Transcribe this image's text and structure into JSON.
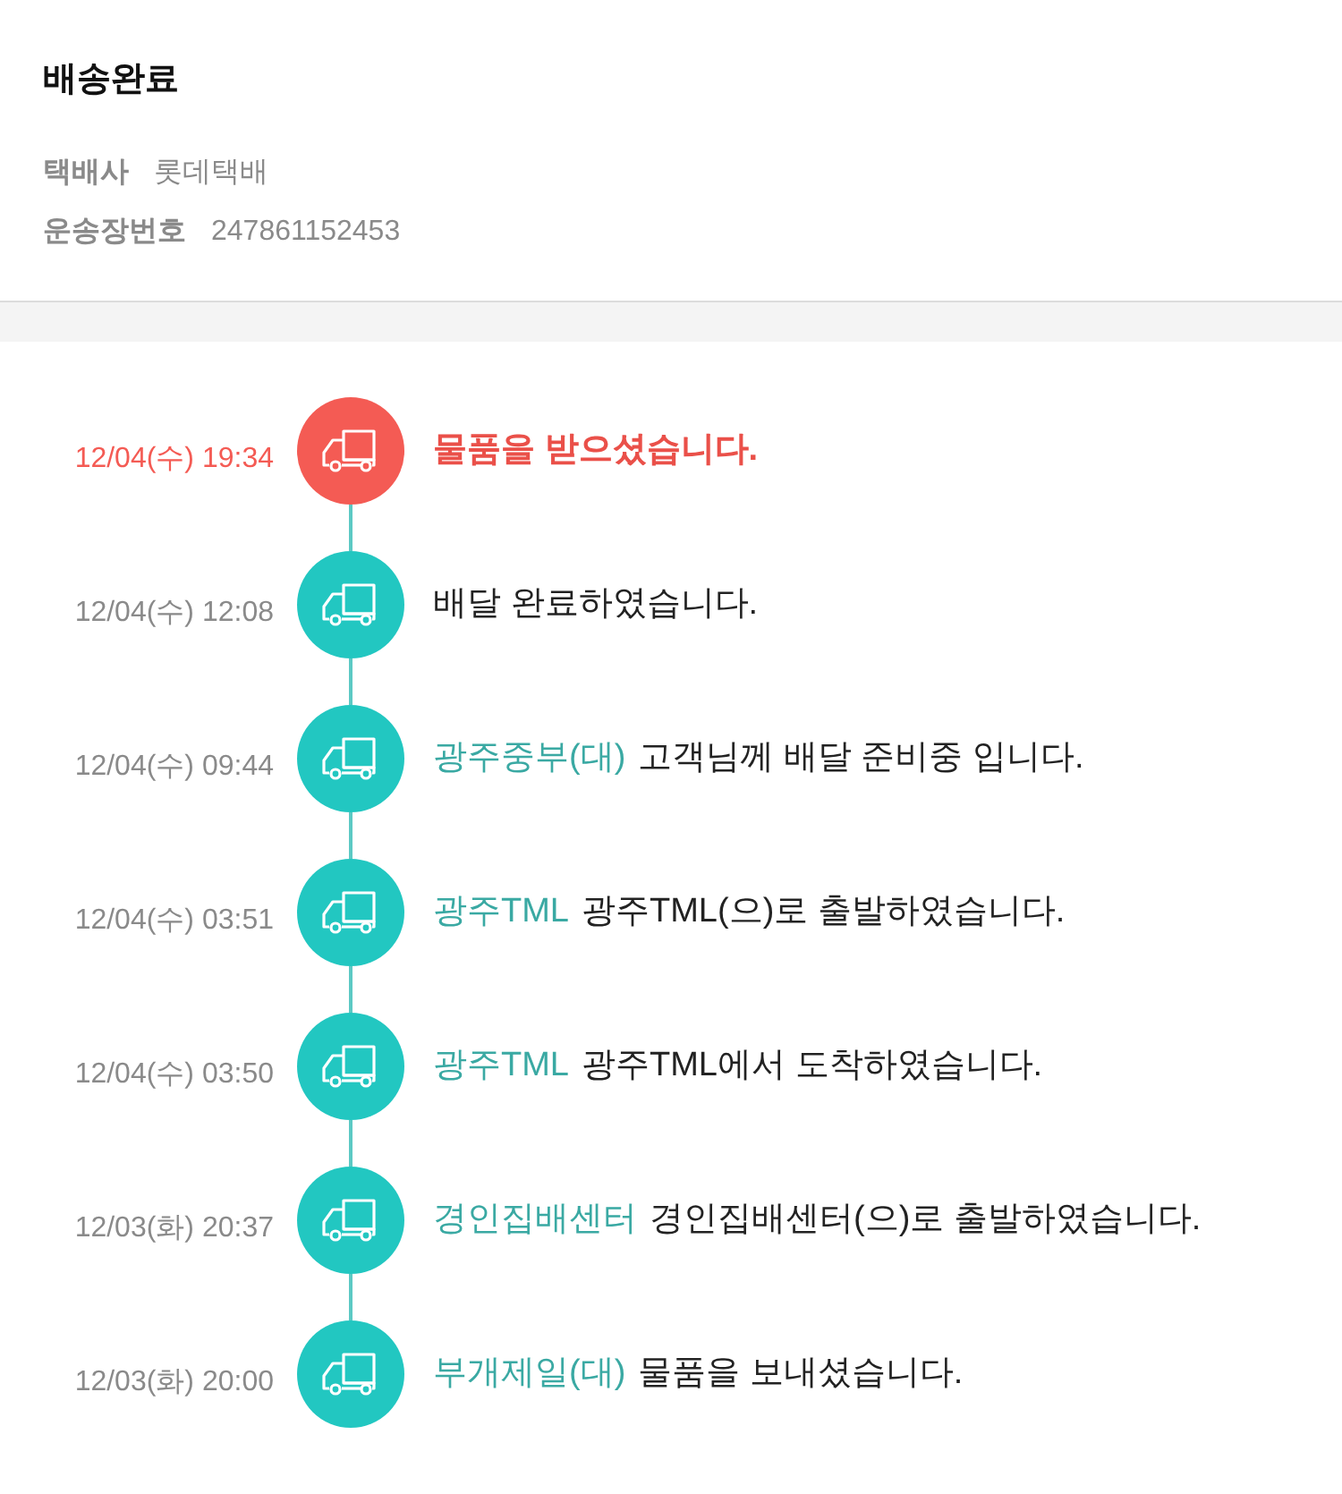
{
  "header": {
    "status": "배송완료",
    "details": [
      {
        "label": "택배사",
        "value": "롯데택배"
      },
      {
        "label": "운송장번호",
        "value": "247861152453"
      }
    ]
  },
  "timeline": [
    {
      "time": "12/04(수) 19:34",
      "message": "물품을 받으셨습니다.",
      "current": true
    },
    {
      "time": "12/04(수) 12:08",
      "message": "배달 완료하였습니다.",
      "current": false
    },
    {
      "time": "12/04(수) 09:44",
      "location": "광주중부(대)",
      "message": "고객님께 배달 준비중 입니다.",
      "current": false
    },
    {
      "time": "12/04(수) 03:51",
      "location": "광주TML",
      "message": "광주TML(으)로 출발하였습니다.",
      "current": false
    },
    {
      "time": "12/04(수) 03:50",
      "location": "광주TML",
      "message": "광주TML에서 도착하였습니다.",
      "current": false
    },
    {
      "time": "12/03(화) 20:37",
      "location": "경인집배센터",
      "message": "경인집배센터(으)로 출발하였습니다.",
      "current": false
    },
    {
      "time": "12/03(화) 20:00",
      "location": "부개제일(대)",
      "message": "물품을 보내셨습니다.",
      "current": false
    }
  ]
}
